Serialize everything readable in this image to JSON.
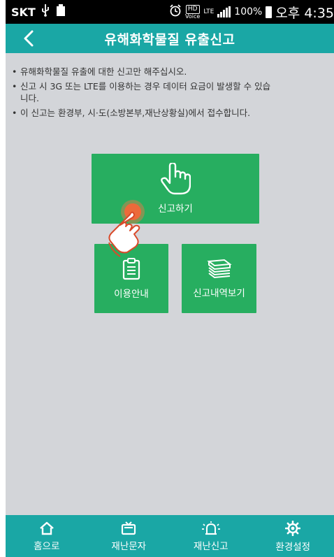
{
  "status_bar": {
    "carrier": "SKT",
    "battery_percent": "100%",
    "clock": "오후 4:35",
    "hd_badge": "HD",
    "hd_sub": "Voice",
    "network": "LTE"
  },
  "header": {
    "title": "유해화학물질 유출신고"
  },
  "notices": [
    "유해화학물질 유출에 대한 신고만 해주십시오.",
    "신고 시 3G 또는 LTE를 이용하는 경우 데이터 요금이 발생할 수 있습\n니다.",
    "이 신고는 환경부, 시·도(소방본부,재난상황실)에서 접수합니다."
  ],
  "buttons": {
    "report": "신고하기",
    "guide": "이용안내",
    "history": "신고내역보기"
  },
  "bottom_nav": [
    {
      "label": "홈으로",
      "icon": "home-icon"
    },
    {
      "label": "재난문자",
      "icon": "tv-icon"
    },
    {
      "label": "재난신고",
      "icon": "siren-icon"
    },
    {
      "label": "환경설정",
      "icon": "gear-icon"
    }
  ],
  "colors": {
    "header": "#1aa7a5",
    "button": "#27ae60",
    "content_bg": "#d3d5d9"
  }
}
